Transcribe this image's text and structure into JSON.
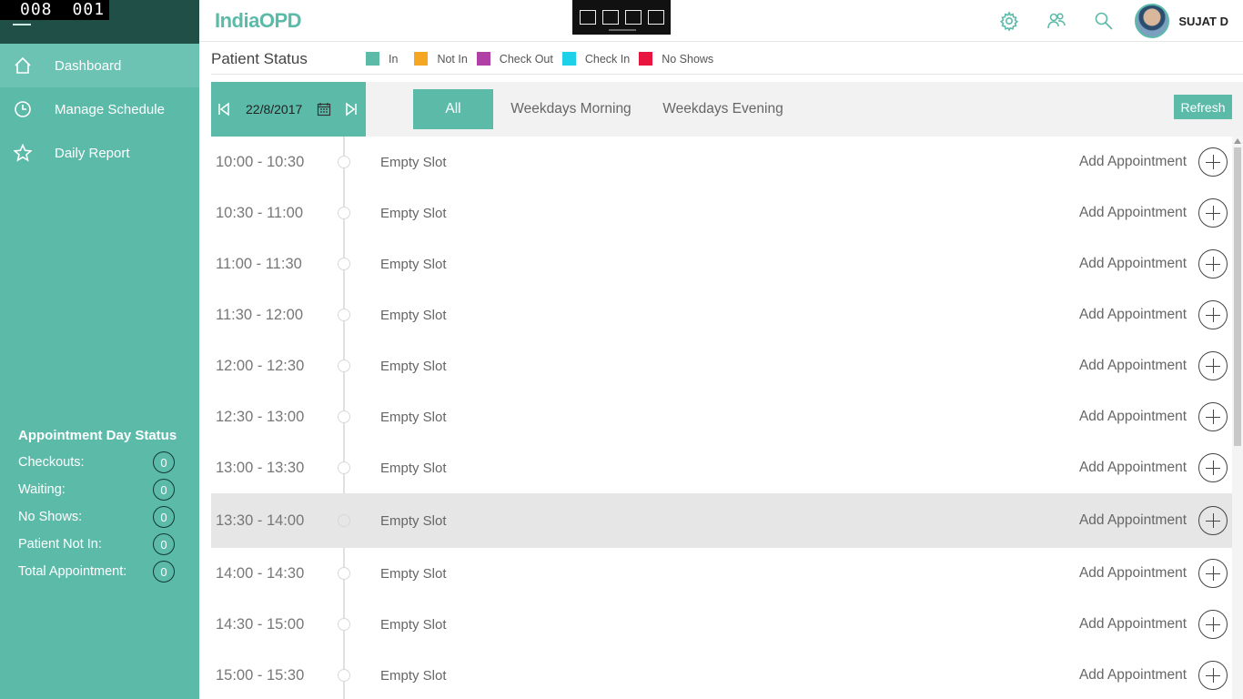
{
  "overlay_counter": [
    "008",
    "001"
  ],
  "app": {
    "logo": "IndiaOPD",
    "user_name": "SUJAT D"
  },
  "sidebar": {
    "items": [
      {
        "label": "Dashboard",
        "icon": "home-icon"
      },
      {
        "label": "Manage Schedule",
        "icon": "clock-icon"
      },
      {
        "label": "Daily Report",
        "icon": "star-icon"
      }
    ],
    "day_status": {
      "title": "Appointment Day Status",
      "rows": [
        {
          "label": "Checkouts:",
          "value": "0"
        },
        {
          "label": "Waiting:",
          "value": "0"
        },
        {
          "label": "No Shows:",
          "value": "0"
        },
        {
          "label": "Patient Not In:",
          "value": "0"
        },
        {
          "label": "Total Appointment:",
          "value": "0"
        }
      ]
    }
  },
  "patient_status": {
    "title": "Patient Status",
    "legend": [
      {
        "label": "In",
        "color": "#5cbaa9"
      },
      {
        "label": "Not In",
        "color": "#f5a623"
      },
      {
        "label": "Check Out",
        "color": "#b03fa6"
      },
      {
        "label": "Check In",
        "color": "#1ed0e8"
      },
      {
        "label": "No Shows",
        "color": "#e8163e"
      }
    ]
  },
  "controls": {
    "date": "22/8/2017",
    "tabs": [
      "All",
      "Weekdays Morning",
      "Weekdays Evening"
    ],
    "active_tab": "All",
    "refresh_label": "Refresh"
  },
  "slots": [
    {
      "time": "10:00 - 10:30",
      "label": "Empty Slot",
      "action": "Add Appointment"
    },
    {
      "time": "10:30 - 11:00",
      "label": "Empty Slot",
      "action": "Add Appointment"
    },
    {
      "time": "11:00 - 11:30",
      "label": "Empty Slot",
      "action": "Add Appointment"
    },
    {
      "time": "11:30 - 12:00",
      "label": "Empty Slot",
      "action": "Add Appointment"
    },
    {
      "time": "12:00 - 12:30",
      "label": "Empty Slot",
      "action": "Add Appointment"
    },
    {
      "time": "12:30 - 13:00",
      "label": "Empty Slot",
      "action": "Add Appointment"
    },
    {
      "time": "13:00 - 13:30",
      "label": "Empty Slot",
      "action": "Add Appointment"
    },
    {
      "time": "13:30 - 14:00",
      "label": "Empty Slot",
      "action": "Add Appointment",
      "highlighted": true
    },
    {
      "time": "14:00 - 14:30",
      "label": "Empty Slot",
      "action": "Add Appointment"
    },
    {
      "time": "14:30 - 15:00",
      "label": "Empty Slot",
      "action": "Add Appointment"
    },
    {
      "time": "15:00 - 15:30",
      "label": "Empty Slot",
      "action": "Add Appointment"
    }
  ]
}
